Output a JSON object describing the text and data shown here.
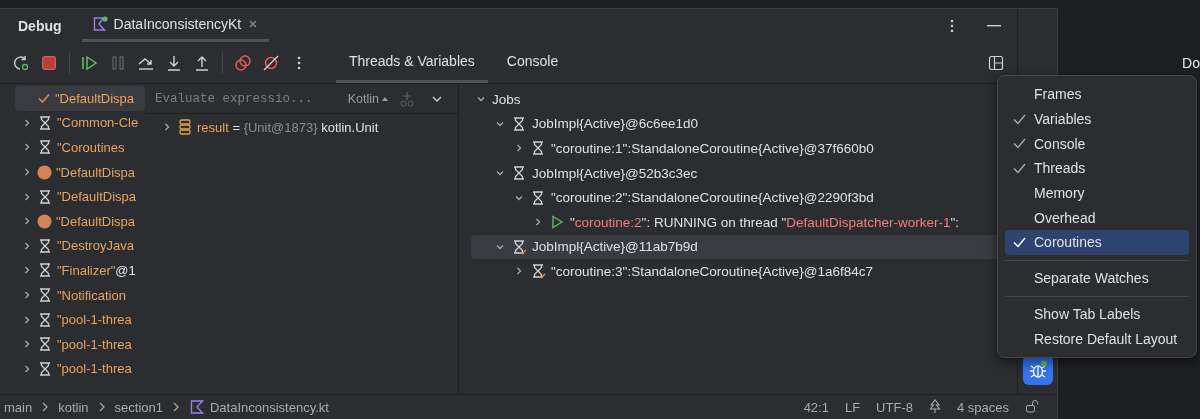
{
  "header": {
    "title": "Debug",
    "session_tab": {
      "label": "DataInconsistencyKt",
      "selected": true
    }
  },
  "view_tabs": [
    {
      "label": "Threads & Variables",
      "selected": true
    },
    {
      "label": "Console",
      "selected": false
    }
  ],
  "threads": [
    {
      "name": "\"DefaultDispa",
      "kind": "check",
      "selected": true
    },
    {
      "name": "\"Common-Cle",
      "kind": "hourglass",
      "selected": false
    },
    {
      "name": "\"Coroutines",
      "kind": "hourglass",
      "selected": false
    },
    {
      "name": "\"DefaultDispa",
      "kind": "dot",
      "selected": false
    },
    {
      "name": "\"DefaultDispa",
      "kind": "hourglass",
      "selected": false
    },
    {
      "name": "\"DefaultDispa",
      "kind": "dot",
      "selected": false
    },
    {
      "name": "\"DestroyJava",
      "kind": "hourglass",
      "selected": false
    },
    {
      "name": "\"Finalizer\"",
      "suffix": "@1",
      "kind": "hourglass",
      "selected": false
    },
    {
      "name": "\"Notification",
      "kind": "hourglass",
      "selected": false
    },
    {
      "name": "\"pool-1-threa",
      "kind": "hourglass",
      "selected": false
    },
    {
      "name": "\"pool-1-threa",
      "kind": "hourglass",
      "selected": false
    },
    {
      "name": "\"pool-1-threa",
      "kind": "hourglass",
      "selected": false
    }
  ],
  "evaluate": {
    "placeholder": "Evaluate expressio...",
    "language": "Kotlin"
  },
  "variables": [
    {
      "name": "result",
      "operator": "=",
      "value": "{Unit@1873}",
      "type": "kotlin.Unit"
    }
  ],
  "jobs": {
    "label": "Jobs",
    "expanded": true,
    "children": [
      {
        "label": "JobImpl{Active}@6c6ee1d0",
        "kind": "hourglass",
        "expanded": true,
        "selected": false,
        "children": [
          {
            "label": "\"coroutine:1\":StandaloneCoroutine{Active}@37f660b0",
            "kind": "hourglass",
            "expanded": false,
            "selected": false
          }
        ]
      },
      {
        "label": "JobImpl{Active}@52b3c3ec",
        "kind": "hourglass",
        "expanded": true,
        "selected": false,
        "children": [
          {
            "label": "\"coroutine:2\":StandaloneCoroutine{Active}@2290f3bd",
            "kind": "hourglass",
            "expanded": true,
            "selected": false,
            "children": [
              {
                "parts": [
                  {
                    "text": "\"",
                    "kind": "plain"
                  },
                  {
                    "text": "coroutine:2",
                    "kind": "name"
                  },
                  {
                    "text": "\": RUNNING on thread \"",
                    "kind": "plain"
                  },
                  {
                    "text": "DefaultDispatcher-worker-1",
                    "kind": "name"
                  },
                  {
                    "text": "\":",
                    "kind": "plain"
                  }
                ],
                "kind": "running",
                "expanded": false,
                "selected": false
              }
            ]
          }
        ]
      },
      {
        "label": "JobImpl{Active}@11ab7b9d",
        "kind": "hourglass-check",
        "expanded": true,
        "selected": true,
        "children": [
          {
            "label": "\"coroutine:3\":StandaloneCoroutine{Active}@1a6f84c7",
            "kind": "hourglass-check",
            "expanded": false,
            "selected": false
          }
        ]
      }
    ]
  },
  "menu": {
    "groups": [
      [
        {
          "label": "Frames",
          "checked": false,
          "selected": false
        },
        {
          "label": "Variables",
          "checked": true,
          "selected": false
        },
        {
          "label": "Console",
          "checked": true,
          "selected": false
        },
        {
          "label": "Threads",
          "checked": true,
          "selected": false
        },
        {
          "label": "Memory",
          "checked": false,
          "selected": false
        },
        {
          "label": "Overhead",
          "checked": false,
          "selected": false
        },
        {
          "label": "Coroutines",
          "checked": true,
          "selected": true
        }
      ],
      [
        {
          "label": "Separate Watches",
          "checked": false,
          "selected": false
        }
      ],
      [
        {
          "label": "Show Tab Labels",
          "checked": false,
          "selected": false
        },
        {
          "label": "Restore Default Layout",
          "checked": false,
          "selected": false
        }
      ]
    ]
  },
  "status_bar": {
    "breadcrumbs": [
      {
        "label": "main",
        "kind": "branch"
      },
      {
        "label": "kotlin",
        "kind": "folder"
      },
      {
        "label": "section1",
        "kind": "folder"
      },
      {
        "label": "DataInconsistency.kt",
        "kind": "file"
      }
    ],
    "items": [
      "42:1",
      "LF",
      "UTF-8"
    ],
    "indent": "4 spaces"
  },
  "backdrop": {
    "text": "Do"
  }
}
